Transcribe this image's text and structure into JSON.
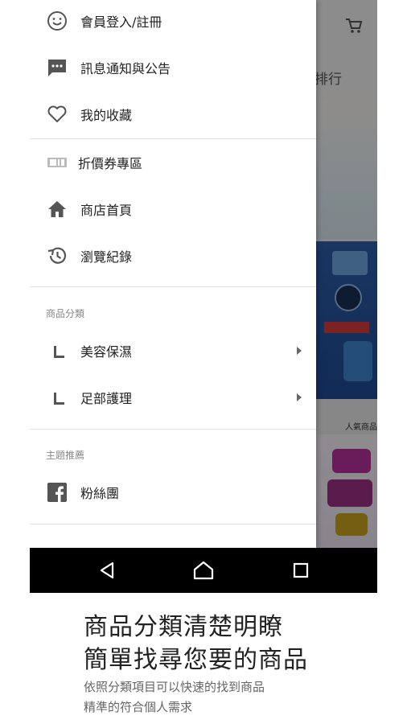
{
  "background_app": {
    "header_tab_fragment": "排行",
    "promo_heading": "人氣商品"
  },
  "drawer": {
    "items": [
      {
        "label": "會員登入/註冊",
        "icon": "smiley-icon"
      },
      {
        "label": "訊息通知與公告",
        "icon": "message-icon"
      },
      {
        "label": "我的收藏",
        "icon": "heart-icon"
      },
      {
        "label": "折價券專區",
        "icon": "coupon-icon"
      },
      {
        "label": "商店首頁",
        "icon": "home-icon"
      },
      {
        "label": "瀏覽紀錄",
        "icon": "history-icon"
      }
    ],
    "categories": {
      "header": "商品分類",
      "items": [
        {
          "label": "美容保濕"
        },
        {
          "label": "足部護理"
        }
      ]
    },
    "topics": {
      "header": "主題推薦",
      "items": [
        {
          "label": "粉絲團",
          "icon": "facebook-icon"
        }
      ]
    }
  },
  "navbar": {
    "back": "back-icon",
    "home": "home-nav-icon",
    "recents": "recents-icon"
  },
  "caption": {
    "headline_line1": "商品分類清楚明瞭",
    "headline_line2": "簡單找尋您要的商品",
    "sub_line1": "依照分類項目可以快速的找到商品",
    "sub_line2": "精準的符合個人需求"
  },
  "colors": {
    "scrim": "#000000",
    "drawer_bg": "#ffffff",
    "navbar_bg": "#000000",
    "icon_gray": "#555555"
  }
}
